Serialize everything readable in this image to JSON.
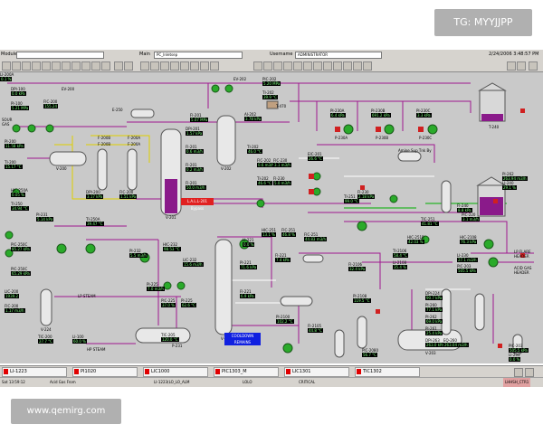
{
  "watermark_top": "TG: MYYJJPP",
  "watermark_bottom": "www.qemirg.com",
  "toolbar": {
    "module_label": "Module",
    "main_label": "Main",
    "main_value": "PC_Inletsep",
    "username_label": "Username",
    "username_value": "ADMINISTRATOR",
    "datetime": "2/24/2006 3:48:57 PM"
  },
  "alarm_bar": [
    "LI-1223",
    "PI1020",
    "LIC1000",
    "PIC1303_M",
    "LIC1301",
    "TIC1302"
  ],
  "status_bar": {
    "time": "Sat 13:59:12",
    "source": "Acid Gas From",
    "tag": "LI-1223(LO_LO_ALM",
    "level": "LOLO",
    "priority": "CRITICAL",
    "right_text": "LHHSH_CTR1"
  },
  "labels": {
    "sour_gas": "SOUR\nGAS",
    "hp_steam": "HP STEAM",
    "lp_steam": "LP STEAM",
    "lp_flare": "LP FLARE\nHEADER",
    "acid_gas_header": "ACID GAS\nHEADER",
    "amine_sump": "Amine Sup Tnk By",
    "cooldown": "COOLDOWN\nREMAINS",
    "alarm_lev": "L.A.L.L-201 Bypass"
  },
  "instruments": [
    {
      "tag": "DPI-100",
      "value": "0.0 kPa"
    },
    {
      "tag": "PI-100",
      "value": "5.21 MPa"
    },
    {
      "tag": "FIC-200",
      "value": "155.24"
    },
    {
      "tag": "EV-200",
      "value": ""
    },
    {
      "tag": "PI-200",
      "value": "11.58 kPa"
    },
    {
      "tag": "TI-200",
      "value": "15.17 °C"
    },
    {
      "tag": "F-200B",
      "value": ""
    },
    {
      "tag": "F-200A",
      "value": ""
    },
    {
      "tag": "DPI-200",
      "value": "3.17 kPa"
    },
    {
      "tag": "FIC-200",
      "value": "1.51 kPa"
    },
    {
      "tag": "HIC-250A",
      "value": "0.05 %"
    },
    {
      "tag": "TI-250",
      "value": "34.94 °C"
    },
    {
      "tag": "TI-250A",
      "value": "39.47 °C"
    },
    {
      "tag": "PIC-250C",
      "value": "85.27 kPa"
    },
    {
      "tag": "PIC-250C",
      "value": "65.29 kPa"
    },
    {
      "tag": "LIC-200",
      "value": "1939.2"
    },
    {
      "tag": "FIC-200",
      "value": "1.17 m3/h"
    },
    {
      "tag": "TIC-200",
      "value": "27.7 °C"
    },
    {
      "tag": "LI-100",
      "value": "60.0 %"
    },
    {
      "tag": "FI-201",
      "value": "5.07 MPa"
    },
    {
      "tag": "DPI-201",
      "value": "1.57 kPa"
    },
    {
      "tag": "FI-201",
      "value": "0.6 m3/h"
    },
    {
      "tag": "FI-201",
      "value": "0.2 m3/h"
    },
    {
      "tag": "FI-201",
      "value": "50.0 m3/h"
    },
    {
      "tag": "AI-202",
      "value": "3.78 kPa"
    },
    {
      "tag": "TI-202",
      "value": "46.0 °C"
    },
    {
      "tag": "EV-202",
      "value": ""
    },
    {
      "tag": "PIC-202",
      "value": "5.20 MPa"
    },
    {
      "tag": "TI-202",
      "value": "39.9 °C"
    },
    {
      "tag": "FIC-202",
      "value": "0.6 m3/h"
    },
    {
      "tag": "TI-202",
      "value": "46.6 °C"
    },
    {
      "tag": "FIC-230",
      "value": "3.1 m3/h"
    },
    {
      "tag": "FI-230",
      "value": "5.0 m3/h"
    },
    {
      "tag": "PI-230A",
      "value": "6.4 kPa"
    },
    {
      "tag": "PI-230B",
      "value": "691.2 kPa"
    },
    {
      "tag": "PI-230C",
      "value": "3.3 kPa"
    },
    {
      "tag": "FI-230",
      "value": "2.18 kPa"
    },
    {
      "tag": "EIC-201",
      "value": "26.6 °C"
    },
    {
      "tag": "HIC-251",
      "value": "13.1 %"
    },
    {
      "tag": "FIC-251",
      "value": "46.8 %"
    },
    {
      "tag": "TI-251",
      "value": "99.0 °C"
    },
    {
      "tag": "FIC-251",
      "value": "44.83 m3/h"
    },
    {
      "tag": "HIC-251B",
      "value": "42.03 %"
    },
    {
      "tag": "TIC-251",
      "value": "41.81 °C"
    },
    {
      "tag": "PI-232",
      "value": "5.5 m3/h"
    },
    {
      "tag": "HIC-232",
      "value": "98.53 °C"
    },
    {
      "tag": "LIC-232",
      "value": "15.6 m3/h"
    },
    {
      "tag": "PI-225",
      "value": "7.0 m3/h"
    },
    {
      "tag": "PIC-225",
      "value": "37.0 %"
    },
    {
      "tag": "PI-225",
      "value": "62.6 °C"
    },
    {
      "tag": "TIC-205",
      "value": "120.0 °C"
    },
    {
      "tag": "LI-221",
      "value": "0.0 %"
    },
    {
      "tag": "PI-221",
      "value": "71.6 kPa"
    },
    {
      "tag": "FI-221",
      "value": "6.9 kPa"
    },
    {
      "tag": "FI-221",
      "value": "7.4 kPa"
    },
    {
      "tag": "PI-2100",
      "value": "102.2 °C"
    },
    {
      "tag": "FI-2105",
      "value": "44.8 °C"
    },
    {
      "tag": "FI-2106",
      "value": "32.4 kPa"
    },
    {
      "tag": "PI-2108",
      "value": "119.5 °C"
    },
    {
      "tag": "TI-2106",
      "value": "58.4 °C"
    },
    {
      "tag": "LI-2108",
      "value": "35.4 %"
    },
    {
      "tag": "HIC-2108",
      "value": "76.3 kPa"
    },
    {
      "tag": "PIC-2080",
      "value": "56.7 °C"
    },
    {
      "tag": "DPI-224",
      "value": "90.7 kPa"
    },
    {
      "tag": "PI-260",
      "value": "77.1 kPa"
    },
    {
      "tag": "PI-262",
      "value": "69.0 kPa"
    },
    {
      "tag": "PI-261",
      "value": "25.4 kPa"
    },
    {
      "tag": "DPI-263",
      "value": "263.0 kPa"
    },
    {
      "tag": "EQ-260",
      "value": "263.04 m3/h"
    },
    {
      "tag": "PI-262",
      "value": "263.94 m3/h"
    },
    {
      "tag": "LI-240",
      "value": "29.1 %"
    },
    {
      "tag": "FI-240",
      "value": "8.8 kPa"
    },
    {
      "tag": "PIC-220",
      "value": "3.1 m3/h"
    },
    {
      "tag": "LI-230",
      "value": "27.1 m3/h"
    },
    {
      "tag": "PIC-203",
      "value": "505.5 kPa"
    },
    {
      "tag": "PIC-203",
      "value": "505.5 kPa"
    },
    {
      "tag": "LI-231",
      "value": "0.0 %"
    },
    {
      "tag": "PI-231",
      "value": "5.14 kPa"
    },
    {
      "tag": "LI-200A",
      "value": "0.1 %"
    }
  ],
  "equipment": [
    "V-200",
    "F-200B",
    "F-200A",
    "V-201",
    "V-202",
    "T-470",
    "T-200",
    "E-250",
    "E-200",
    "E-210",
    "P-230A",
    "P-230B",
    "P-230C",
    "T-251",
    "T-250",
    "V-220",
    "V-230",
    "V-203",
    "V-204",
    "V-224",
    "V-205",
    "P-200",
    "P-201",
    "AC-250",
    "AC-250B",
    "AC-251",
    "AC-251A",
    "AC-260",
    "P-231",
    "E-225",
    "E-225A",
    "V-225",
    "P-235",
    "L-230",
    "T-240"
  ]
}
